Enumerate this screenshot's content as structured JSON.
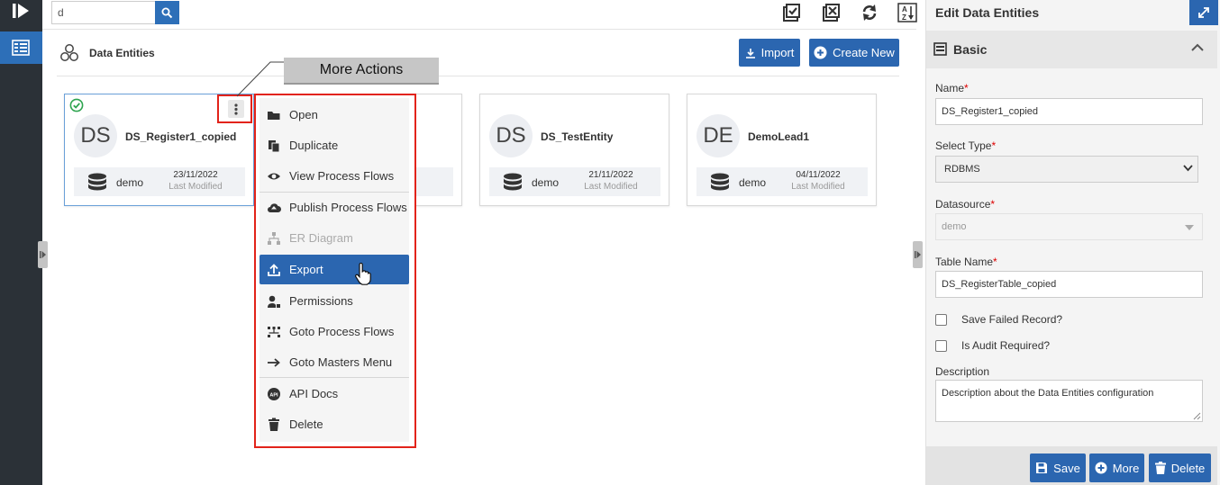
{
  "search": {
    "value": "d"
  },
  "page": {
    "title": "Data Entities"
  },
  "actions": {
    "import_label": "Import",
    "create_label": "Create New"
  },
  "cards": [
    {
      "initials": "DS",
      "name": "DS_Register1_copied",
      "datasource": "demo",
      "date": "23/11/2022",
      "modified_label": "Last Modified"
    },
    {
      "initials": "",
      "name": "",
      "datasource": "",
      "date": "",
      "modified_label": ""
    },
    {
      "initials": "DS",
      "name": "DS_TestEntity",
      "datasource": "demo",
      "date": "21/11/2022",
      "modified_label": "Last Modified"
    },
    {
      "initials": "DE",
      "name": "DemoLead1",
      "datasource": "demo",
      "date": "04/11/2022",
      "modified_label": "Last Modified"
    }
  ],
  "callout": {
    "label": "More Actions"
  },
  "menu": {
    "items": [
      {
        "label": "Open",
        "icon": "folder-open-icon"
      },
      {
        "label": "Duplicate",
        "icon": "copy-icon"
      },
      {
        "label": "View Process Flows",
        "icon": "eye-icon"
      },
      {
        "label": "Publish Process Flows",
        "icon": "cloud-upload-icon"
      },
      {
        "label": "ER Diagram",
        "icon": "sitemap-icon",
        "disabled": true
      },
      {
        "label": "Export",
        "icon": "upload-icon",
        "active": true
      },
      {
        "label": "Permissions",
        "icon": "user-lock-icon"
      },
      {
        "label": "Goto Process Flows",
        "icon": "workflow-icon"
      },
      {
        "label": "Goto Masters Menu",
        "icon": "arrow-right-icon"
      },
      {
        "label": "API Docs",
        "icon": "api-icon"
      },
      {
        "label": "Delete",
        "icon": "trash-icon"
      }
    ]
  },
  "panel": {
    "title": "Edit Data Entities",
    "section": "Basic",
    "name_label": "Name",
    "name_value": "DS_Register1_copied",
    "type_label": "Select Type",
    "type_value": "RDBMS",
    "datasource_label": "Datasource",
    "datasource_value": "demo",
    "table_label": "Table Name",
    "table_value": "DS_RegisterTable_copied",
    "save_failed_label": "Save Failed Record?",
    "audit_label": "Is Audit Required?",
    "description_label": "Description",
    "description_value": "Description about the Data Entities configuration",
    "required_mark": "*"
  },
  "footer": {
    "save_label": "Save",
    "more_label": "More",
    "delete_label": "Delete"
  },
  "colors": {
    "primary": "#2b66b0",
    "highlight": "#e2231a",
    "rail": "#2b31370"
  }
}
